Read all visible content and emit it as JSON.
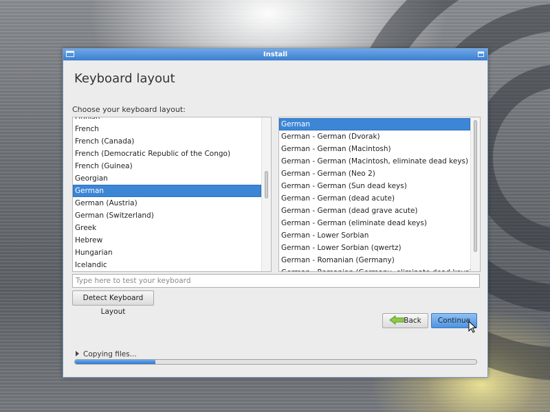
{
  "window": {
    "title": "Install"
  },
  "page": {
    "heading": "Keyboard layout",
    "choose_label": "Choose your keyboard layout:"
  },
  "layouts": {
    "items": [
      "Finnish",
      "French",
      "French (Canada)",
      "French (Democratic Republic of the Congo)",
      "French (Guinea)",
      "Georgian",
      "German",
      "German (Austria)",
      "German (Switzerland)",
      "Greek",
      "Hebrew",
      "Hungarian",
      "Icelandic"
    ],
    "selected": "German"
  },
  "variants": {
    "items": [
      "German",
      "German - German (Dvorak)",
      "German - German (Macintosh)",
      "German - German (Macintosh, eliminate dead keys)",
      "German - German (Neo 2)",
      "German - German (Sun dead keys)",
      "German - German (dead acute)",
      "German - German (dead grave acute)",
      "German - German (eliminate dead keys)",
      "German - Lower Sorbian",
      "German - Lower Sorbian (qwertz)",
      "German - Romanian (Germany)",
      "German - Romanian (Germany, eliminate dead keys)"
    ],
    "selected": "German"
  },
  "test_input": {
    "placeholder": "Type here to test your keyboard",
    "value": ""
  },
  "buttons": {
    "detect": "Detect Keyboard Layout",
    "back": "Back",
    "continue": "Continue"
  },
  "status": {
    "copying": "Copying files...",
    "progress": 0.2
  },
  "colors": {
    "accent": "#3d86d6",
    "titlebar": "#4f8fd8",
    "back_arrow": "#7ec23a"
  },
  "icons": {
    "window_menu": "window-menu-icon",
    "maximize": "maximize-icon",
    "back": "back-arrow-icon",
    "expander": "expander-arrow-icon",
    "cursor": "mouse-pointer-icon"
  }
}
